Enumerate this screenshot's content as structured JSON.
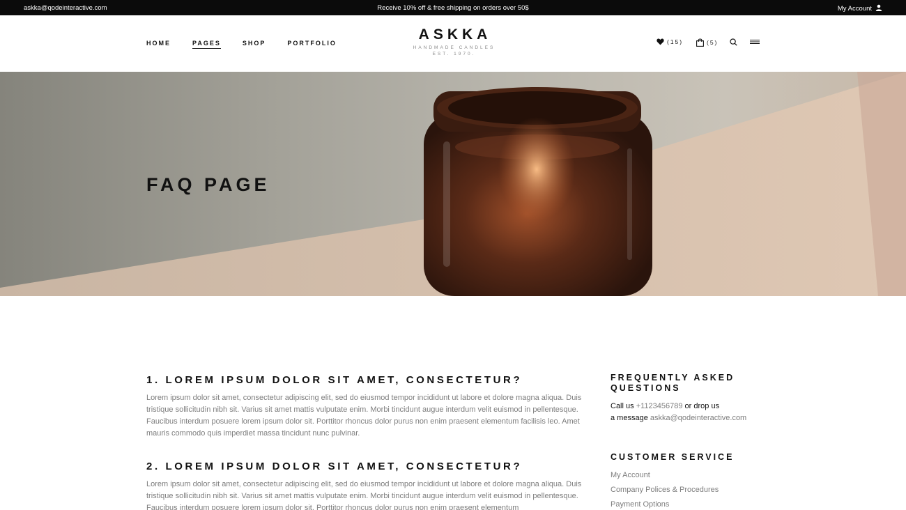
{
  "topbar": {
    "email": "askka@qodeinteractive.com",
    "promo": "Receive 10% off & free shipping on orders over 50$",
    "account_label": "My Account",
    "account_icon": "user-icon"
  },
  "nav": {
    "items": [
      {
        "label": "HOME",
        "active": false
      },
      {
        "label": "PAGES",
        "active": true
      },
      {
        "label": "SHOP",
        "active": false
      },
      {
        "label": "PORTFOLIO",
        "active": false
      }
    ]
  },
  "logo": {
    "name": "ASKKA",
    "tagline": "HANDMADE CANDLES",
    "est": "EST. 1970."
  },
  "tools": {
    "wishlist_count": "(15)",
    "wishlist_icon": "heart-icon",
    "cart_count": "(5)",
    "cart_icon": "shopping-bag-icon",
    "search_icon": "search-icon",
    "menu_icon": "hamburger-menu-icon"
  },
  "hero": {
    "title": "FAQ PAGE"
  },
  "faq": {
    "items": [
      {
        "question": "1. LOREM IPSUM DOLOR SIT AMET, CONSECTETUR?",
        "answer": "Lorem ipsum dolor sit amet, consectetur adipiscing elit, sed do eiusmod tempor incididunt ut labore et dolore magna aliqua. Duis tristique sollicitudin nibh sit. Varius sit amet mattis vulputate enim. Morbi tincidunt augue interdum velit euismod in pellentesque. Faucibus interdum posuere lorem ipsum dolor sit. Porttitor rhoncus dolor purus non enim praesent elementum facilisis leo. Amet mauris commodo quis imperdiet massa tincidunt nunc pulvinar."
      },
      {
        "question": "2. LOREM IPSUM DOLOR SIT AMET, CONSECTETUR?",
        "answer": "Lorem ipsum dolor sit amet, consectetur adipiscing elit, sed do eiusmod tempor incididunt ut labore et dolore magna aliqua. Duis tristique sollicitudin nibh sit. Varius sit amet mattis vulputate enim. Morbi tincidunt augue interdum velit euismod in pellentesque. Faucibus interdum posuere lorem ipsum dolor sit. Porttitor rhoncus dolor purus non enim praesent elementum"
      }
    ]
  },
  "sidebar": {
    "faq_title_line1": "FREQUENTLY ASKED",
    "faq_title_line2": "QUESTIONS",
    "contact_call": "Call us",
    "contact_phone": "+1123456789",
    "contact_or": "or drop us",
    "contact_message": "a message",
    "contact_email": "askka@qodeinteractive.com",
    "service_title": "CUSTOMER SERVICE",
    "service_links": [
      "My Account",
      "Company Polices & Procedures",
      "Payment Options"
    ]
  }
}
